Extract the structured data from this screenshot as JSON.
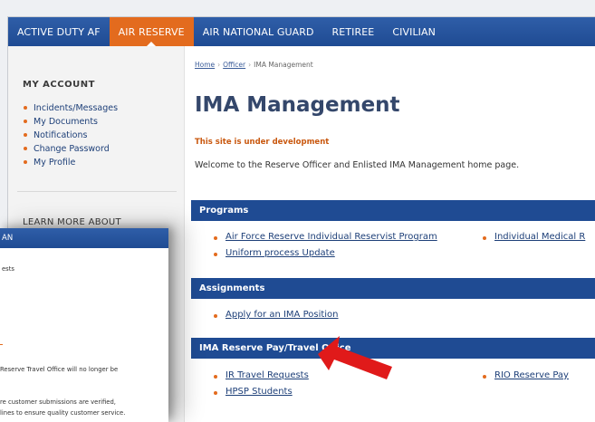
{
  "nav": {
    "items": [
      "ACTIVE DUTY AF",
      "AIR RESERVE",
      "AIR NATIONAL GUARD",
      "RETIREE",
      "CIVILIAN"
    ],
    "active_index": 1
  },
  "sidebar": {
    "account_title": "MY ACCOUNT",
    "account_items": [
      "Incidents/Messages",
      "My Documents",
      "Notifications",
      "Change Password",
      "My Profile"
    ],
    "learn_title": "LEARN MORE ABOUT"
  },
  "breadcrumb": {
    "home": "Home",
    "officer": "Officer",
    "current": "IMA Management",
    "separator": "›"
  },
  "page": {
    "title": "IMA Management",
    "dev_note": "This site is under development",
    "welcome": "Welcome to the Reserve Officer and Enlisted IMA Management home page."
  },
  "sections": {
    "programs": {
      "title": "Programs",
      "links": [
        "Air Force Reserve Individual Reservist Program",
        "Uniform process Update",
        "Individual Medical R"
      ]
    },
    "assignments": {
      "title": "Assignments",
      "links": [
        "Apply for an IMA Position"
      ]
    },
    "pay_travel": {
      "title": "IMA Reserve Pay/Travel Office",
      "links": [
        "IR Travel Requests",
        "HPSP Students",
        "RIO Reserve Pay"
      ]
    }
  },
  "overlay": {
    "bar_text": "AN",
    "lines": [
      "ests",
      "Reserve Travel Office will no longer be",
      "re customer submissions are verified,",
      "lines to ensure quality customer service."
    ]
  },
  "colors": {
    "nav_blue": "#1f4b93",
    "accent_orange": "#e36b1e",
    "arrow_red": "#e01a1a",
    "title_navy": "#34476b"
  },
  "icons": {
    "arrow": "red-pointer-arrow"
  }
}
